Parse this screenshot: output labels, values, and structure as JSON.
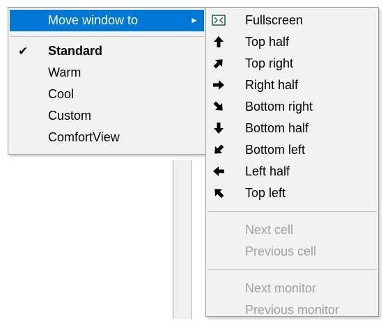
{
  "main_menu": {
    "move_window": "Move window to",
    "arrow": "►",
    "items": [
      {
        "label": "Standard",
        "checked": true
      },
      {
        "label": "Warm"
      },
      {
        "label": "Cool"
      },
      {
        "label": "Custom"
      },
      {
        "label": "ComfortView"
      }
    ],
    "check_glyph": "✔"
  },
  "sub_menu": {
    "positions": [
      {
        "label": "Fullscreen",
        "icon": "fullscreen-icon"
      },
      {
        "label": "Top half",
        "icon": "arrow-up-icon"
      },
      {
        "label": "Top right",
        "icon": "arrow-up-right-icon"
      },
      {
        "label": "Right half",
        "icon": "arrow-right-icon"
      },
      {
        "label": "Bottom right",
        "icon": "arrow-down-right-icon"
      },
      {
        "label": "Bottom half",
        "icon": "arrow-down-icon"
      },
      {
        "label": "Bottom left",
        "icon": "arrow-down-left-icon"
      },
      {
        "label": "Left half",
        "icon": "arrow-left-icon"
      },
      {
        "label": "Top left",
        "icon": "arrow-up-left-icon"
      }
    ],
    "cells": [
      {
        "label": "Next cell",
        "disabled": true
      },
      {
        "label": "Previous cell",
        "disabled": true
      }
    ],
    "monitors": [
      {
        "label": "Next monitor",
        "disabled": true
      },
      {
        "label": "Previous monitor",
        "disabled": true
      }
    ]
  },
  "colors": {
    "highlight": "#0078d7",
    "disabled_text": "#a0a0a0",
    "menu_bg": "#f2f2f2",
    "fullscreen_icon": "#1a6e3a"
  }
}
